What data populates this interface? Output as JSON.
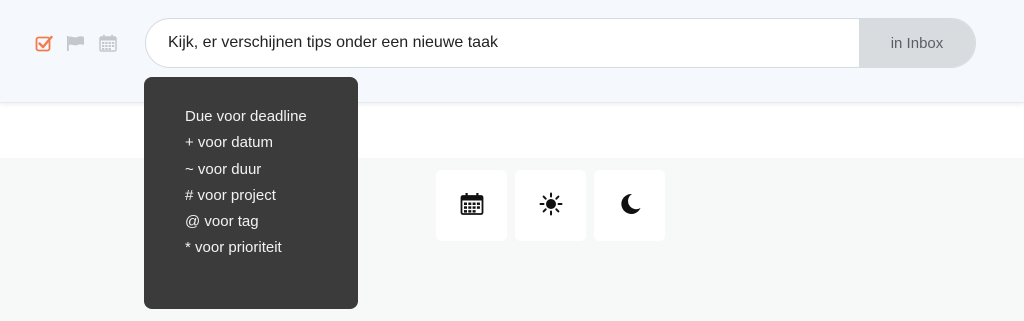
{
  "toolbar": {
    "icons": [
      "checkbox-checked-icon",
      "flag-icon",
      "calendar-icon"
    ],
    "colors": {
      "checkbox": "#f07c4f",
      "muted": "#c3c8ce"
    }
  },
  "task_input": {
    "value": "Kijk, er verschijnen tips onder een nieuwe taak"
  },
  "inbox_button": {
    "label": "in Inbox"
  },
  "tips": {
    "lines": [
      "Due voor deadline",
      "+ voor datum",
      "~ voor duur",
      "# voor project",
      "@ voor tag",
      "* voor prioriteit"
    ]
  },
  "views": {
    "buttons": [
      "calendar-icon",
      "sun-icon",
      "moon-icon"
    ]
  }
}
